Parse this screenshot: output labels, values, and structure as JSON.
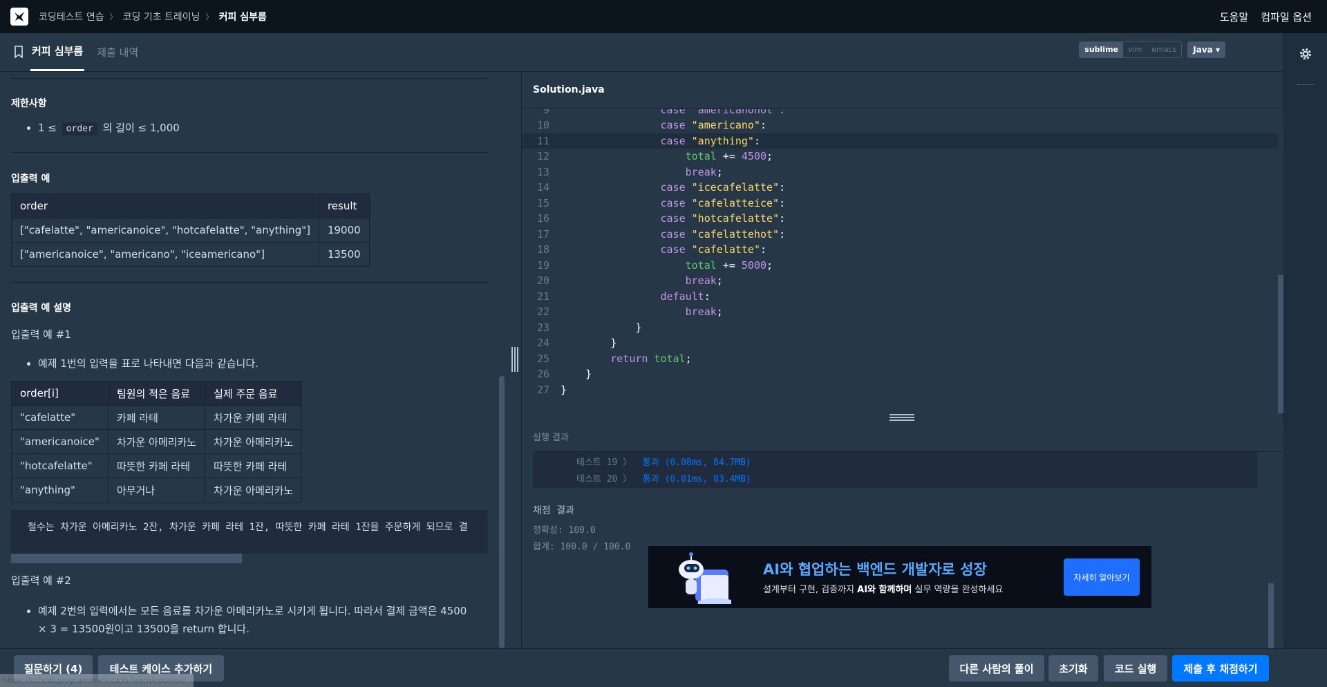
{
  "topnav": {
    "breadcrumb": [
      "코딩테스트 연습",
      "코딩 기초 트레이닝",
      "커피 심부름"
    ],
    "help": "도움말",
    "compile_options": "컴파일 옵션"
  },
  "tabs": {
    "problem": "커피 심부름",
    "submissions": "제출 내역"
  },
  "editor_settings": {
    "keymaps": [
      "sublime",
      "vim",
      "emacs"
    ],
    "selected_keymap": "sublime",
    "language": "Java"
  },
  "problem": {
    "constraints_title": "제한사항",
    "constraint": {
      "prefix": "1 ≤",
      "code": "order",
      "suffix": "의 길이 ≤ 1,000"
    },
    "io_title": "입출력 예",
    "io_table": {
      "headers": [
        "order",
        "result"
      ],
      "rows": [
        [
          "[\"cafelatte\", \"americanoice\", \"hotcafelatte\", \"anything\"]",
          "19000"
        ],
        [
          "[\"americanoice\", \"americano\", \"iceamericano\"]",
          "13500"
        ]
      ]
    },
    "explain_title": "입출력 예 설명",
    "ex1_title": "입출력 예 #1",
    "ex1_bullet": "예제 1번의 입력을 표로 나타내면 다음과 같습니다.",
    "ex1_table": {
      "headers": [
        "order[i]",
        "팀원의 적은 음료",
        "실제 주문 음료"
      ],
      "rows": [
        [
          "\"cafelatte\"",
          "카페 라테",
          "차가운 카페 라테"
        ],
        [
          "\"americanoice\"",
          "차가운 아메리카노",
          "차가운 아메리카노"
        ],
        [
          "\"hotcafelatte\"",
          "따뜻한 카페 라테",
          "따뜻한 카페 라테"
        ],
        [
          "\"anything\"",
          "아무거나",
          "차가운 아메리카노"
        ]
      ]
    },
    "ex1_pre": "철수는 차가운 아메리카노 2잔, 차가운 카페 라테 1잔, 따뜻한 카페 라테 1잔을 주문하게 되므로 결",
    "ex2_title": "입출력 예 #2",
    "ex2_bullet_line1": "예제 2번의 입력에서는 모든 음료를 차가운 아메리카노로 시키게 됩니다. 따라서 결제 금액은 4500",
    "ex2_bullet_line2": "× 3 = 13500원이고 13500을 return 합니다."
  },
  "editor": {
    "filename": "Solution.java",
    "partial_top_line": "                case \"americanohot\":",
    "lines": [
      {
        "n": "10",
        "parts": [
          [
            "pl",
            "                "
          ],
          [
            "kw",
            "case"
          ],
          [
            "pl",
            " "
          ],
          [
            "str",
            "\"americano\""
          ],
          [
            "pl",
            ":"
          ]
        ]
      },
      {
        "n": "11",
        "parts": [
          [
            "pl",
            "                "
          ],
          [
            "kw",
            "case"
          ],
          [
            "pl",
            " "
          ],
          [
            "str",
            "\"anything\""
          ],
          [
            "pl",
            ":"
          ]
        ],
        "current": true
      },
      {
        "n": "12",
        "parts": [
          [
            "pl",
            "                    "
          ],
          [
            "var",
            "total"
          ],
          [
            "pl",
            " += "
          ],
          [
            "num",
            "4500"
          ],
          [
            "pl",
            ";"
          ]
        ]
      },
      {
        "n": "13",
        "parts": [
          [
            "pl",
            "                    "
          ],
          [
            "kw",
            "break"
          ],
          [
            "pl",
            ";"
          ]
        ]
      },
      {
        "n": "14",
        "parts": [
          [
            "pl",
            "                "
          ],
          [
            "kw",
            "case"
          ],
          [
            "pl",
            " "
          ],
          [
            "str",
            "\"icecafelatte\""
          ],
          [
            "pl",
            ":"
          ]
        ]
      },
      {
        "n": "15",
        "parts": [
          [
            "pl",
            "                "
          ],
          [
            "kw",
            "case"
          ],
          [
            "pl",
            " "
          ],
          [
            "str",
            "\"cafelatteice\""
          ],
          [
            "pl",
            ":"
          ]
        ]
      },
      {
        "n": "16",
        "parts": [
          [
            "pl",
            "                "
          ],
          [
            "kw",
            "case"
          ],
          [
            "pl",
            " "
          ],
          [
            "str",
            "\"hotcafelatte\""
          ],
          [
            "pl",
            ":"
          ]
        ]
      },
      {
        "n": "17",
        "parts": [
          [
            "pl",
            "                "
          ],
          [
            "kw",
            "case"
          ],
          [
            "pl",
            " "
          ],
          [
            "str",
            "\"cafelattehot\""
          ],
          [
            "pl",
            ":"
          ]
        ]
      },
      {
        "n": "18",
        "parts": [
          [
            "pl",
            "                "
          ],
          [
            "kw",
            "case"
          ],
          [
            "pl",
            " "
          ],
          [
            "str",
            "\"cafelatte\""
          ],
          [
            "pl",
            ":"
          ]
        ]
      },
      {
        "n": "19",
        "parts": [
          [
            "pl",
            "                    "
          ],
          [
            "var",
            "total"
          ],
          [
            "pl",
            " += "
          ],
          [
            "num",
            "5000"
          ],
          [
            "pl",
            ";"
          ]
        ]
      },
      {
        "n": "20",
        "parts": [
          [
            "pl",
            "                    "
          ],
          [
            "kw",
            "break"
          ],
          [
            "pl",
            ";"
          ]
        ]
      },
      {
        "n": "21",
        "parts": [
          [
            "pl",
            "                "
          ],
          [
            "kw",
            "default"
          ],
          [
            "pl",
            ":"
          ]
        ]
      },
      {
        "n": "22",
        "parts": [
          [
            "pl",
            "                    "
          ],
          [
            "kw",
            "break"
          ],
          [
            "pl",
            ";"
          ]
        ]
      },
      {
        "n": "23",
        "parts": [
          [
            "pl",
            "            }"
          ]
        ]
      },
      {
        "n": "24",
        "parts": [
          [
            "pl",
            "        }"
          ]
        ]
      },
      {
        "n": "25",
        "parts": [
          [
            "pl",
            "        "
          ],
          [
            "kw",
            "return"
          ],
          [
            "pl",
            " "
          ],
          [
            "var",
            "total"
          ],
          [
            "pl",
            ";"
          ]
        ]
      },
      {
        "n": "26",
        "parts": [
          [
            "pl",
            "    }"
          ]
        ]
      },
      {
        "n": "27",
        "parts": [
          [
            "pl",
            "}"
          ]
        ]
      }
    ]
  },
  "result": {
    "title": "실행 결과",
    "tests": [
      {
        "label": "테스트 19 〉",
        "status": "통과 (0.08ms, 84.7MB)"
      },
      {
        "label": "테스트 20 〉",
        "status": "통과 (0.01ms, 83.4MB)"
      }
    ],
    "grading_title": "채점 결과",
    "accuracy": "정확성: 100.0",
    "total": "합계: 100.0 / 100.0"
  },
  "ad": {
    "title": "AI와 협업하는 백엔드 개발자로 성장",
    "subtitle_pre": "설계부터 구현, 검증까지 ",
    "subtitle_bold": "AI와 함께하며",
    "subtitle_post": " 실무 역량을 완성하세요",
    "button": "자세히 알아보기"
  },
  "buttons": {
    "question": "질문하기 (4)",
    "add_testcase": "테스트 케이스 추가하기",
    "others_solutions": "다른 사람의 풀이",
    "reset": "초기화",
    "run": "코드 실행",
    "submit": "제출 후 채점하기"
  },
  "status_url": "https://school.programmers.co.kr/learn/courses/..."
}
